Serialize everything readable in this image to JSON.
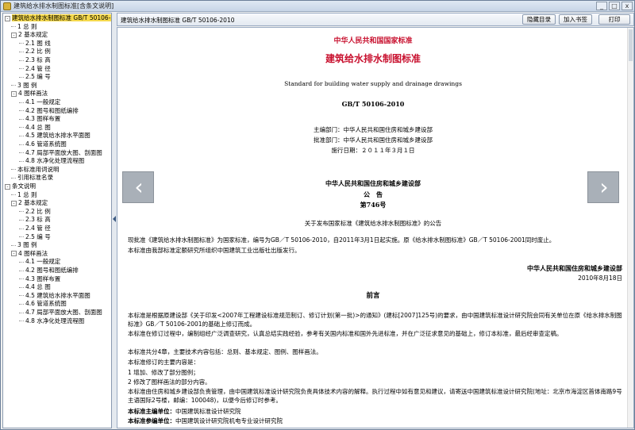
{
  "window": {
    "title": "建筑给水排水制图标准[含条文说明]",
    "buttons": [
      "_",
      "□",
      "x"
    ]
  },
  "toolbar": {
    "doc_title": "建筑给水排水制图标准 GB/T 50106-2010",
    "hide_toc_label": "隐藏目录",
    "add_bookmark_label": "加入书签",
    "print_label": "打印"
  },
  "tree": [
    {
      "label": "建筑给水排水制图标准 GB/T 50106-2010",
      "level": 0,
      "toggle": "-",
      "selected": true
    },
    {
      "label": "1 总 则",
      "level": 1
    },
    {
      "label": "2 基本规定",
      "level": 1,
      "toggle": "-"
    },
    {
      "label": "2.1 图 线",
      "level": 2
    },
    {
      "label": "2.2 比 例",
      "level": 2
    },
    {
      "label": "2.3 标 高",
      "level": 2
    },
    {
      "label": "2.4 管 径",
      "level": 2
    },
    {
      "label": "2.5 编 号",
      "level": 2
    },
    {
      "label": "3 图 例",
      "level": 1
    },
    {
      "label": "4 图样画法",
      "level": 1,
      "toggle": "-"
    },
    {
      "label": "4.1 一般规定",
      "level": 2
    },
    {
      "label": "4.2 图号和图纸编排",
      "level": 2
    },
    {
      "label": "4.3 图样布置",
      "level": 2
    },
    {
      "label": "4.4 总 图",
      "level": 2
    },
    {
      "label": "4.5 建筑给水排水平面图",
      "level": 2
    },
    {
      "label": "4.6 管道系统图",
      "level": 2
    },
    {
      "label": "4.7 局部平面放大图、剖面图",
      "level": 2
    },
    {
      "label": "4.8 水净化处理流程图",
      "level": 2
    },
    {
      "label": "本标准用词说明",
      "level": 1
    },
    {
      "label": "引用标准名录",
      "level": 1
    },
    {
      "label": "条文说明",
      "level": 0,
      "toggle": "-"
    },
    {
      "label": "1 总 则",
      "level": 1
    },
    {
      "label": "2 基本规定",
      "level": 1,
      "toggle": "-"
    },
    {
      "label": "2.2 比 例",
      "level": 2
    },
    {
      "label": "2.3 标 高",
      "level": 2
    },
    {
      "label": "2.4 管 径",
      "level": 2
    },
    {
      "label": "2.5 编 号",
      "level": 2
    },
    {
      "label": "3 图 例",
      "level": 1
    },
    {
      "label": "4 图样画法",
      "level": 1,
      "toggle": "-"
    },
    {
      "label": "4.1 一般规定",
      "level": 2
    },
    {
      "label": "4.2 图号和图纸编排",
      "level": 2
    },
    {
      "label": "4.3 图样布置",
      "level": 2
    },
    {
      "label": "4.4 总 图",
      "level": 2
    },
    {
      "label": "4.5 建筑给水排水平面图",
      "level": 2
    },
    {
      "label": "4.6 管道系统图",
      "level": 2
    },
    {
      "label": "4.7 局部平面放大图、剖面图",
      "level": 2
    },
    {
      "label": "4.8 水净化处理流程图",
      "level": 2
    }
  ],
  "doc": {
    "national_standard": "中华人民共和国国家标准",
    "title_cn": "建筑给水排水制图标准",
    "title_en": "Standard for building water supply and drainage drawings",
    "code": "GB/T 50106-2010",
    "editor": "主编部门：中华人民共和国住房和城乡建设部",
    "approver": "批准部门：中华人民共和国住房和城乡建设部",
    "effective": "施行日期：２０１１年３月１日",
    "ministry": "中华人民共和国住房和城乡建设部",
    "announce": "公　告",
    "number": "第746号",
    "announce_title": "关于发布国家标准《建筑给水排水制图标准》的公告",
    "announce_p1": "现批准《建筑给水排水制图标准》为国家标准，编号为GB／T 50106-2010，自2011年3月1日起实施。原《给水排水制图标准》GB／T 50106-2001同时废止。",
    "announce_p2": "本标准由我部标准定额研究所组织中国建筑工业出版社出版发行。",
    "sign_org": "中华人民共和国住房和城乡建设部",
    "sign_date": "2010年8月18日",
    "foreword_title": "前言",
    "fw1": "本标准是根据原建设部《关于印发<2007年工程建设标准规范制订、修订计划(第一批)>的通知》(建标[2007]125号)的要求，由中国建筑标准设计研究院会同有关单位在原《给水排水制图标准》GB／T 50106-2001的基础上修订而成。",
    "fw2": "本标准在修订过程中，编制组经广泛调查研究，认真总结实践经验，参考有关国内标准和国外先进标准，并在广泛征求意见的基础上，修订本标准，最后经审查定稿。",
    "fw3": "本标准共分4章，主要技术内容包括：总则、基本规定、图例、图样画法。",
    "fw4": "本标准修订的主要内容是：",
    "fw5": "1 增加、修改了部分图例；",
    "fw6": "2 修改了图样画法的部分内容。",
    "fw7": "本标准由住房和城乡建设部负责管理，由中国建筑标准设计研究院负责具体技术内容的解释。执行过程中如有意见和建议，请寄送中国建筑标准设计研究院(地址：北京市海淀区首体南路9号主语国际2号楼，邮编：100048)，以便今后修订时参考。",
    "chief_label": "本标准主编单位：",
    "chief_value": "中国建筑标准设计研究院",
    "partner_label": "本标准参编单位：",
    "partner_value": "中国建筑设计研究院机电专业设计研究院"
  },
  "nav": {
    "prev": "‹",
    "next": "›"
  }
}
